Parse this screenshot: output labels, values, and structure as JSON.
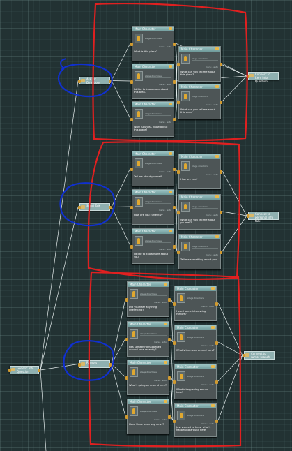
{
  "hubs": {
    "root": "Generic Info Question",
    "branch_a": "Ask for Directions",
    "branch_b": "Small Talk",
    "branch_c": "Rumors",
    "connect_a": "Connect to Item Info Question",
    "connect_b": "Connect to personal info talk",
    "connect_c": "Connect to rumor branch"
  },
  "node_common": {
    "speaker": "Main Character",
    "stage": "stage directions",
    "direction": "menu · auto"
  },
  "nodes": {
    "a1": "What is this place?",
    "a2": "I'd like to know more about this area.",
    "a3": "Wait! Sounds - know about this place?",
    "a4": "What can you tell me about this place?",
    "a5": "What can you tell me about this area?",
    "b1": "Tell me about yourself.",
    "b2": "How are you currently?",
    "b3": "I'd like to know more about you.",
    "b4": "How are you?",
    "b5": "What can you tell me about yourself?",
    "b6": "Tell me something about you.",
    "c1": "Did you hear anything interesting?",
    "c2": "Has something happened around here recently?",
    "c3": "What's going on around here?",
    "c4": "Have there been any news?",
    "c5": "Heard some interesting rumors?",
    "c6": "What's the news around here?",
    "c7": "What's happening around here?",
    "c8": "Just wanted to know what's happening around here."
  },
  "colors": {
    "background": "#223233",
    "wire": "#e6eeee",
    "red_annotation": "#e02020",
    "blue_annotation": "#1030d0"
  }
}
